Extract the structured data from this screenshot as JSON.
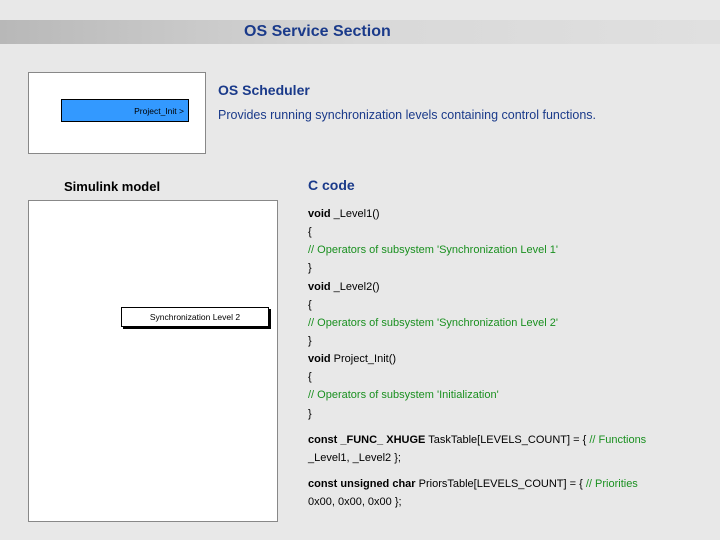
{
  "header": {
    "title": "OS Service Section"
  },
  "scheduler": {
    "heading": "OS Scheduler",
    "description": "Provides running synchronization levels containing control functions.",
    "thumb_label": "Project_Init >"
  },
  "labels": {
    "simulink": "Simulink model",
    "ccode": "C code",
    "sync_block": "Synchronization Level 2"
  },
  "code": {
    "l1_sig_kw": "void",
    "l1_sig_rest": " _Level1()",
    "brace_open": "{",
    "l1_comment": "   // Operators of subsystem 'Synchronization Level 1'",
    "brace_close": "}",
    "l2_sig_kw": "void",
    "l2_sig_rest": " _Level2()",
    "l2_comment": "   // Operators of subsystem 'Synchronization Level 2'",
    "pi_sig_kw": "void",
    "pi_sig_rest": " Project_Init()",
    "pi_comment": "   // Operators of subsystem 'Initialization'",
    "tt_kw": "const _FUNC_ XHUGE",
    "tt_rest": " TaskTable[LEVELS_COUNT] = {",
    "tt_cm": "    // Functions",
    "tt_body": "  _Level1, _Level2 };",
    "pt_kw": "const unsigned char",
    "pt_rest": " PriorsTable[LEVELS_COUNT] = {",
    "pt_cm": "      // Priorities",
    "pt_body": "  0x00, 0x00, 0x00 };"
  }
}
